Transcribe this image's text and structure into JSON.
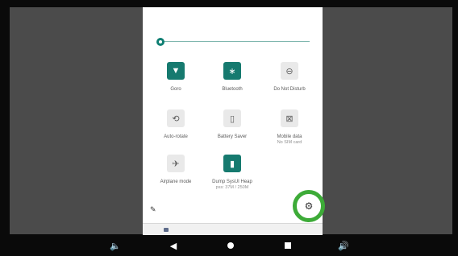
{
  "quick_settings": {
    "tiles": [
      {
        "label": "Goro",
        "sub": "",
        "icon": "wifi-icon",
        "glyph": "▼",
        "active": true
      },
      {
        "label": "Bluetooth",
        "sub": "",
        "icon": "bluetooth-icon",
        "glyph": "∗",
        "active": true
      },
      {
        "label": "Do Not Disturb",
        "sub": "",
        "icon": "dnd-icon",
        "glyph": "⊖",
        "active": false
      },
      {
        "label": "Auto-rotate",
        "sub": "",
        "icon": "auto-rotate-icon",
        "glyph": "⟲",
        "active": false
      },
      {
        "label": "Battery Saver",
        "sub": "",
        "icon": "battery-icon",
        "glyph": "▯",
        "active": false
      },
      {
        "label": "Mobile data",
        "sub": "No SIM card",
        "icon": "no-sim-icon",
        "glyph": "⊠",
        "active": false
      },
      {
        "label": "Airplane mode",
        "sub": "",
        "icon": "airplane-icon",
        "glyph": "✈",
        "active": false
      },
      {
        "label": "Dump SysUI Heap",
        "sub": "pss: 37M / 250M",
        "icon": "memory-icon",
        "glyph": "▮",
        "active": true
      }
    ],
    "wifi_more": "⋮",
    "edit_glyph": "✎",
    "settings_glyph": "⚙"
  },
  "nav": {
    "volume_down": "🔈",
    "back": "◀",
    "volume_up": "🔊"
  },
  "colors": {
    "accent": "#167a6f",
    "highlight_ring": "#3dab38"
  }
}
